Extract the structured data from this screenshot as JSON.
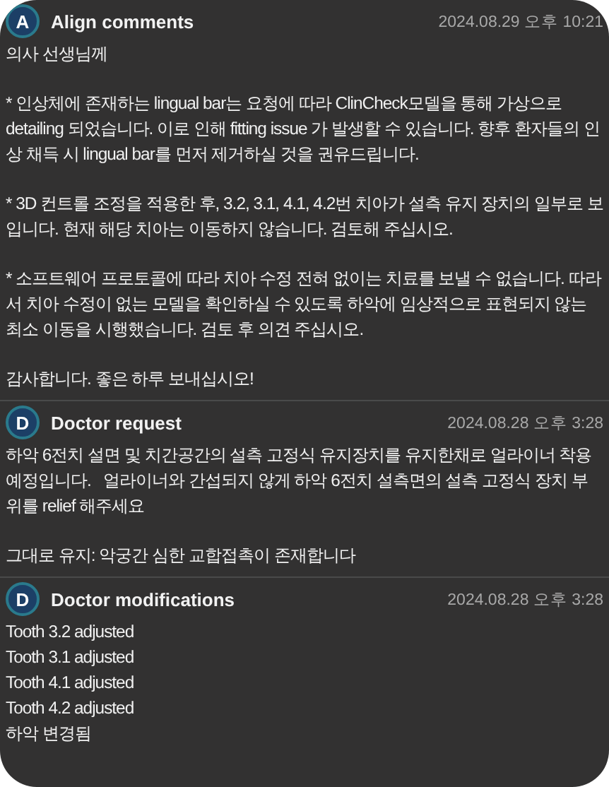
{
  "comments": [
    {
      "initial": "A",
      "title": "Align comments",
      "time": "2024.08.29 오후 10:21",
      "kind": "prose",
      "paragraphs": [
        "의사 선생님께",
        "* 인상체에 존재하는 lingual bar는 요청에 따라 ClinCheck모델을 통해 가상으로 detailing 되었습니다. 이로 인해 fitting issue 가 발생할 수 있습니다. 향후 환자들의 인상 채득 시 lingual bar를 먼저 제거하실 것을 권유드립니다.",
        "* 3D 컨트롤 조정을 적용한 후, 3.2, 3.1, 4.1, 4.2번 치아가 설측 유지 장치의 일부로 보입니다. 현재 해당 치아는 이동하지 않습니다. 검토해 주십시오.",
        "* 소프트웨어 프로토콜에 따라 치아 수정 전혀 없이는 치료를 보낼 수 없습니다. 따라서 치아 수정이 없는 모델을 확인하실 수 있도록 하악에 임상적으로 표현되지 않는 최소 이동을 시행했습니다. 검토 후 의견 주십시오.",
        "감사합니다. 좋은 하루 보내십시오!"
      ]
    },
    {
      "initial": "D",
      "title": "Doctor request",
      "time": "2024.08.28 오후 3:28",
      "kind": "prose",
      "paragraphs": [
        "하악 6전치 설면 및 치간공간의 설측 고정식 유지장치를 유지한채로 얼라이너 착용 예정입니다.   얼라이너와 간섭되지 않게 하악 6전치 설측면의 설측 고정식 장치 부위를 relief 해주세요",
        "그대로 유지: 악궁간 심한 교합접촉이 존재합니다"
      ]
    },
    {
      "initial": "D",
      "title": "Doctor modifications",
      "time": "2024.08.28 오후 3:28",
      "kind": "list",
      "paragraphs": [
        "Tooth 3.2 adjusted",
        "Tooth 3.1 adjusted",
        "Tooth 4.1 adjusted",
        "Tooth 4.2 adjusted",
        "하악 변경됨"
      ]
    }
  ]
}
